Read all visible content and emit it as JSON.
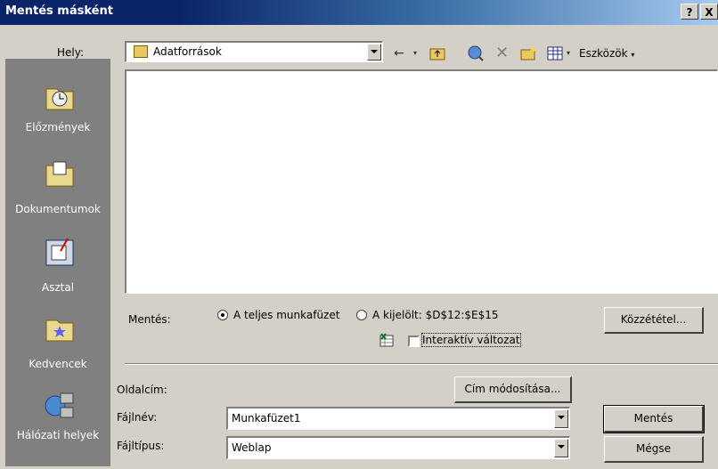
{
  "dialog": {
    "title": "Mentés másként",
    "help_btn": "?",
    "close_btn": "X"
  },
  "location": {
    "label": "Hely:",
    "value": "Adatforrások"
  },
  "toolbar": {
    "back_icon": "←",
    "up_icon": "⇧",
    "tools_label": "Eszközök"
  },
  "places": [
    {
      "label": "Előzmények",
      "icon": "history-icon"
    },
    {
      "label": "Dokumentumok",
      "icon": "documents-folder-icon"
    },
    {
      "label": "Asztal",
      "icon": "desktop-icon"
    },
    {
      "label": "Kedvencek",
      "icon": "favorites-folder-icon"
    },
    {
      "label": "Hálózati helyek",
      "icon": "network-places-icon"
    }
  ],
  "save_options": {
    "label": "Mentés:",
    "option_workbook": "A teljes munkafüzet",
    "option_selection": "A kijelölt: $D$12:$E$15",
    "interactive": "Interaktív változat",
    "publish_button": "Közzététel..."
  },
  "page_title": {
    "label": "Oldalcím:",
    "change_button": "Cím módosítása..."
  },
  "filename": {
    "label": "Fájlnév:",
    "value": "Munkafüzet1"
  },
  "filetype": {
    "label": "Fájltípus:",
    "value": "Weblap"
  },
  "buttons": {
    "save": "Mentés",
    "cancel": "Mégse"
  }
}
